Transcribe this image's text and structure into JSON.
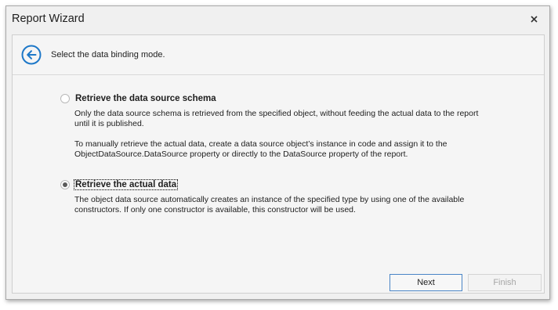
{
  "window": {
    "title": "Report Wizard"
  },
  "header": {
    "instruction": "Select the data binding mode."
  },
  "options": [
    {
      "label": "Retrieve the data source schema",
      "selected": false,
      "description_lines": [
        "Only the data source schema is retrieved from the specified object, without feeding the actual data to the report",
        "until it is published."
      ],
      "note_lines": [
        "To manually retrieve the actual data, create a data source object’s instance in code and assign it to the",
        "ObjectDataSource.DataSource property or directly to the DataSource property of the report."
      ]
    },
    {
      "label": "Retrieve the actual data",
      "selected": true,
      "description_lines": [
        "The object data source automatically creates an instance of the specified type by using one of the available",
        "constructors. If only one constructor is available, this constructor will be used."
      ]
    }
  ],
  "footer": {
    "next_label": "Next",
    "finish_label": "Finish"
  },
  "icons": {
    "back": "arrow-left-circle-icon",
    "close": "close-icon"
  },
  "colors": {
    "accent": "#1e78c8",
    "focus_border": "#4a85c6"
  }
}
